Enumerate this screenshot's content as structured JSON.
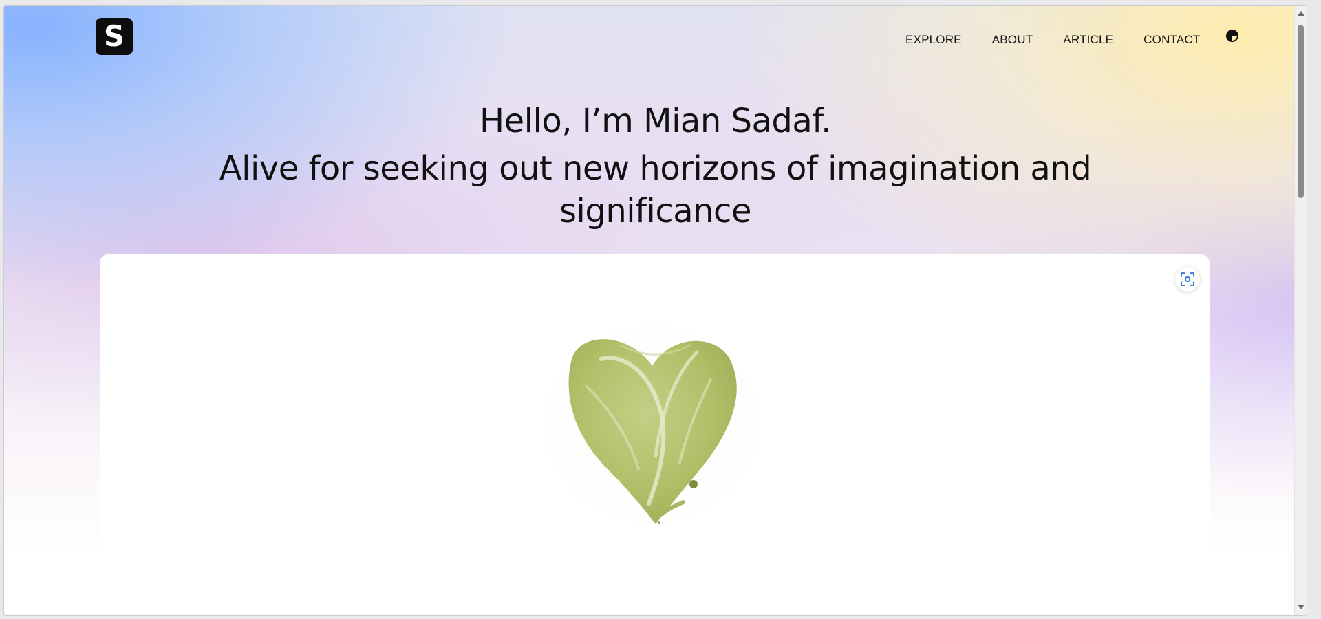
{
  "logo": {
    "letter": "S"
  },
  "nav": {
    "items": [
      {
        "label": "EXPLORE"
      },
      {
        "label": "ABOUT"
      },
      {
        "label": "ARTICLE"
      },
      {
        "label": "CONTACT"
      }
    ],
    "theme_toggle_icon": "contrast-icon"
  },
  "hero": {
    "greeting": "Hello, I’m Mian Sadaf.",
    "tagline": "Alive for seeking out new horizons of imagination and significance"
  },
  "showcase": {
    "focus_button_icon": "focus-scan-icon",
    "image_subject": "green-paint-heart"
  },
  "colors": {
    "text": "#111111",
    "logo_bg": "#0d0d0d",
    "accent": "#2f6fd6",
    "heart": "#b5c46b"
  }
}
